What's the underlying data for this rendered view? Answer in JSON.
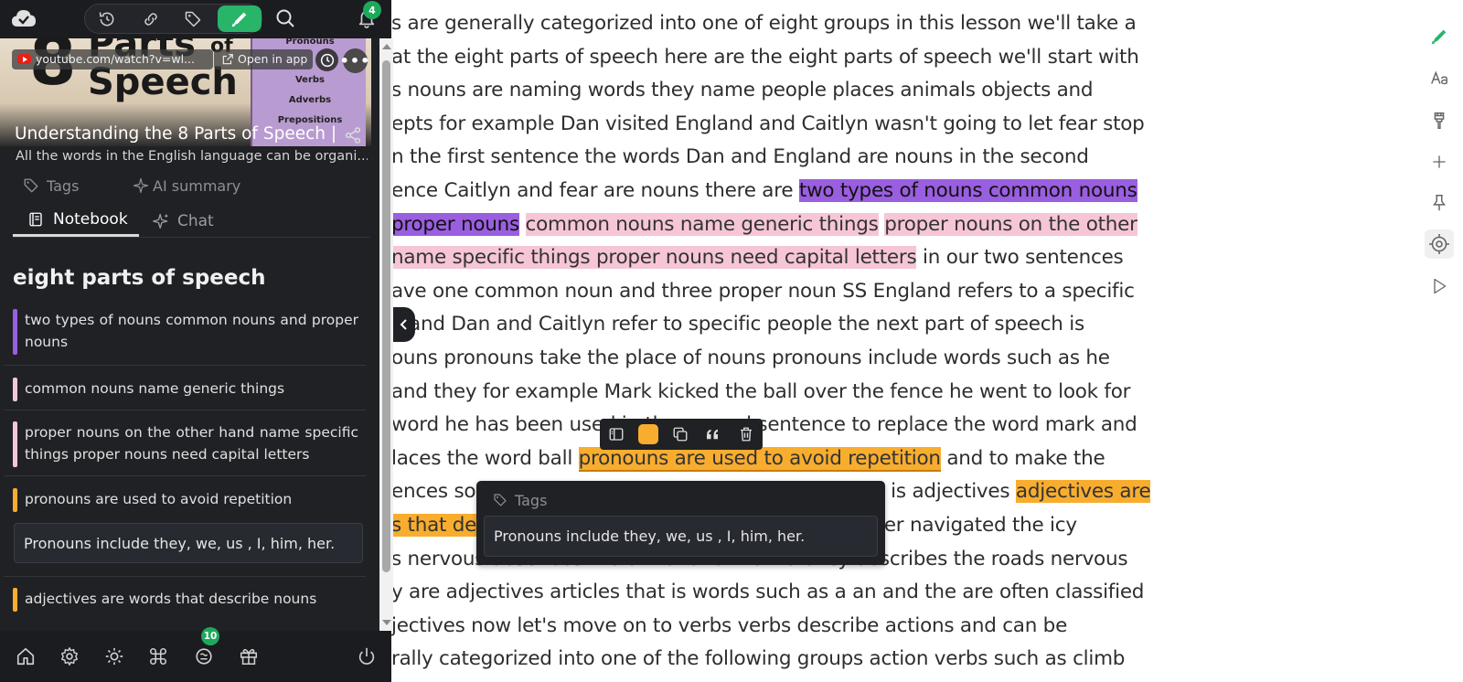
{
  "reader": {
    "lines": [
      {
        "segments": [
          {
            "text": "s are generally categorized into one of eight groups in this lesson we'll take a",
            "hl": ""
          }
        ]
      },
      {
        "segments": [
          {
            "text": "at the eight parts of speech here are the eight parts of speech we'll start with",
            "hl": ""
          }
        ]
      },
      {
        "segments": [
          {
            "text": "s nouns are naming words they name people places animals objects and",
            "hl": ""
          }
        ]
      },
      {
        "segments": [
          {
            "text": "epts for example Dan visited England and Caitlyn wasn't going to let fear stop",
            "hl": ""
          }
        ]
      },
      {
        "segments": [
          {
            "text": "n the first sentence the words Dan and England are nouns in the second",
            "hl": ""
          }
        ]
      },
      {
        "segments": [
          {
            "text": "ence Caitlyn and fear are nouns there are ",
            "hl": ""
          },
          {
            "text": "two types of nouns common nouns",
            "hl": "purple"
          }
        ]
      },
      {
        "segments": [
          {
            "text": "proper nouns",
            "hl": "purple"
          },
          {
            "text": " ",
            "hl": ""
          },
          {
            "text": "common nouns name generic things",
            "hl": "pink"
          },
          {
            "text": " ",
            "hl": ""
          },
          {
            "text": "proper nouns on the other",
            "hl": "pink"
          }
        ]
      },
      {
        "segments": [
          {
            "text": " name specific things proper nouns need capital letters",
            "hl": "pink"
          },
          {
            "text": " in our two sentences",
            "hl": ""
          }
        ]
      },
      {
        "segments": [
          {
            "text": "ave one common noun and three proper noun SS England refers to a specific",
            "hl": ""
          }
        ]
      },
      {
        "segments": [
          {
            "text": "y and Dan and Caitlyn refer to specific people the next part of speech is",
            "hl": ""
          }
        ]
      },
      {
        "segments": [
          {
            "text": "ouns pronouns take the place of nouns pronouns include words such as he",
            "hl": ""
          }
        ]
      },
      {
        "segments": [
          {
            "text": " and they for example Mark kicked the ball over the fence he went to look for",
            "hl": ""
          }
        ]
      },
      {
        "segments": [
          {
            "text": " word he has been used in the second sentence to replace the word mark and",
            "hl": ""
          }
        ]
      },
      {
        "segments": [
          {
            "text": "laces the word ball ",
            "hl": ""
          },
          {
            "text": "pronouns are used to avoid repetition",
            "hl": "orange"
          },
          {
            "text": " and to make the",
            "hl": ""
          }
        ]
      },
      {
        "segments": [
          {
            "text": "ences sound less repetitive the next part of speech is adjectives ",
            "hl": ""
          },
          {
            "text": "adjectives are",
            "hl": "orange-flat"
          }
        ]
      },
      {
        "segments": [
          {
            "text": "s that describe nouns",
            "hl": "orange-flat"
          },
          {
            "text": " for example the nervous driver navigated the icy",
            "hl": ""
          }
        ]
      },
      {
        "segments": [
          {
            "text": "s nervous describes the driver and the word icy describes the roads nervous",
            "hl": ""
          }
        ]
      },
      {
        "segments": [
          {
            "text": "y are adjectives articles that is words such as a an and the are often classified",
            "hl": ""
          }
        ]
      },
      {
        "segments": [
          {
            "text": "jectives now let's move on to verbs verbs describe actions and can be",
            "hl": ""
          }
        ]
      },
      {
        "segments": [
          {
            "text": "rally categorized into one of the following groups action verbs such as climb",
            "hl": ""
          }
        ]
      }
    ]
  },
  "topbar": {
    "notification_count": "4"
  },
  "video": {
    "thumb_number": "8",
    "thumb_parts": "Parts",
    "thumb_of": "of",
    "thumb_speech": "Speech",
    "thumb_list": [
      "Pronouns",
      "Verbs",
      "Adverbs",
      "Prepositions"
    ],
    "url": "youtube.com/watch?v=wl...",
    "open_in_app": "Open in app",
    "title": "Understanding the 8 Parts of Speech | ...",
    "description": "All the words in the English language can be organi..."
  },
  "meta": {
    "tags_label": "Tags",
    "ai_summary_label": "AI summary"
  },
  "tabs": {
    "notebook": "Notebook",
    "chat": "Chat"
  },
  "notebook": {
    "title": "eight parts of speech",
    "notes": [
      {
        "text": "two types of nouns common nouns and proper nouns",
        "color": "#9a5ee0"
      },
      {
        "text": "common nouns name generic things",
        "color": "#f6c6d6"
      },
      {
        "text": "proper nouns on the other hand name specific things proper nouns need capital letters",
        "color": "#f6c6d6"
      },
      {
        "text": "pronouns are used to avoid repetition",
        "color": "#f8ad2e"
      },
      {
        "text": "adjectives are words that describe nouns",
        "color": "#f8ad2e"
      }
    ],
    "comment": "Pronouns include they, we, us , I, him, her."
  },
  "bottombar": {
    "badge_count": "10"
  },
  "popover": {
    "tags_placeholder": "Tags",
    "comment": "Pronouns include they, we, us , I, him, her."
  },
  "colors": {
    "accent_green": "#28b469",
    "purple_highlight": "#9a5ee0",
    "pink_highlight": "#f6c6d6",
    "orange_highlight": "#f8ad2e"
  }
}
